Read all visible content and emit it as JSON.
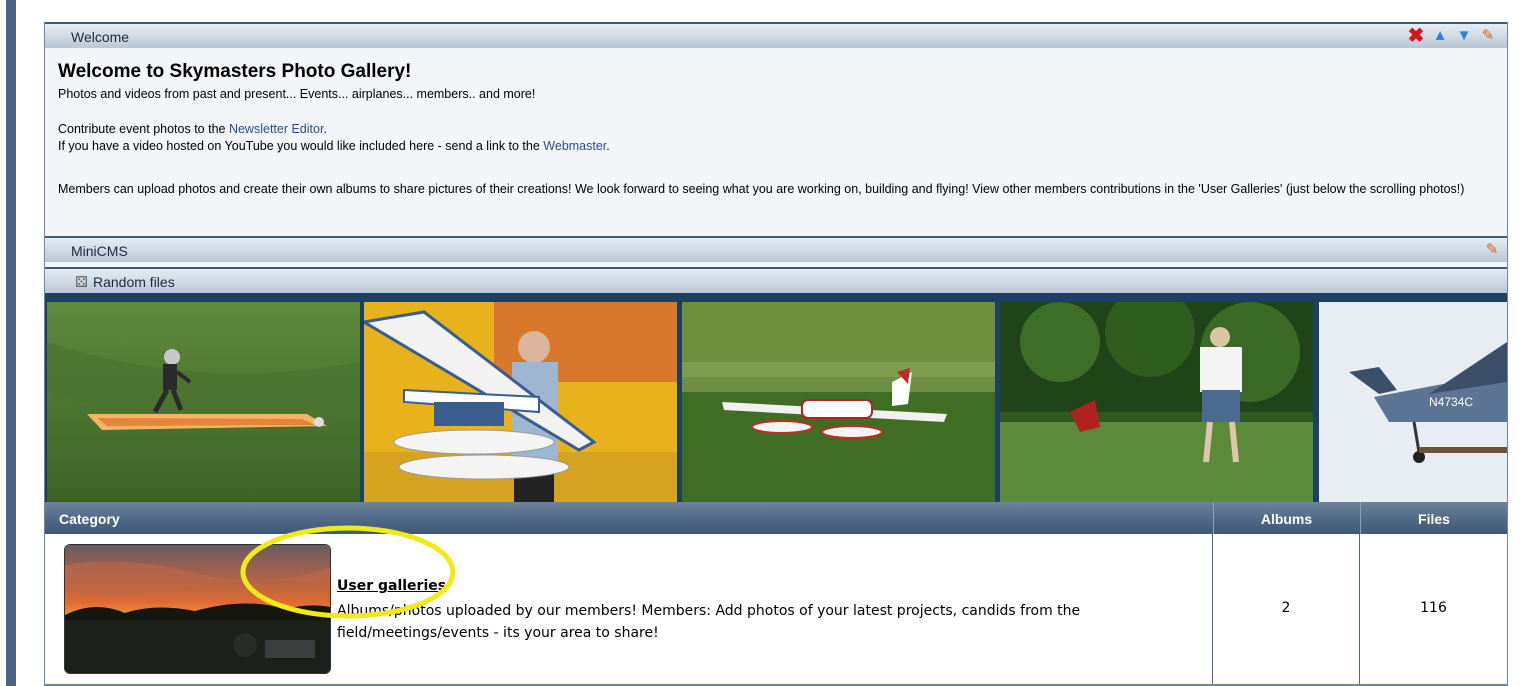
{
  "welcome": {
    "bar_label": "Welcome",
    "title": "Welcome to Skymasters Photo Gallery!",
    "tagline": "Photos and videos from past and present... Events... airplanes... members.. and more!",
    "contribute_prefix": "Contribute event photos to the ",
    "newsletter_link": "Newsletter Editor",
    "contribute_suffix": ".",
    "video_prefix": "If you have a video hosted on YouTube you would like included here - send a link to the ",
    "webmaster_link": "Webmaster",
    "video_suffix": ".",
    "members_text": "Members can upload photos and create their own albums to share pictures of their creations! We look forward to seeing what you are working on, building and flying! View other members contributions in the 'User Galleries' (just below the scrolling photos!)",
    "tool_icons": [
      "close-icon",
      "move-up-icon",
      "move-down-icon",
      "edit-icon"
    ]
  },
  "minicms": {
    "bar_label": "MiniCMS"
  },
  "random_files": {
    "bar_label": "Random files",
    "photos": [
      "rc plane with surfboard",
      "seaplane model",
      "twin engine model",
      "pilot on field",
      "plane N4734C"
    ]
  },
  "categories": {
    "headers": {
      "category": "Category",
      "albums": "Albums",
      "files": "Files"
    },
    "rows": [
      {
        "title": "User galleries",
        "description": "Albums/photos uploaded by our members! Members: Add photos of your latest projects, candids from the field/meetings/events - its your area to share!",
        "albums": "2",
        "files": "116"
      }
    ]
  },
  "colors": {
    "accent": "#40587a",
    "link": "#2b4f8b",
    "highlight": "#f2ea16"
  }
}
